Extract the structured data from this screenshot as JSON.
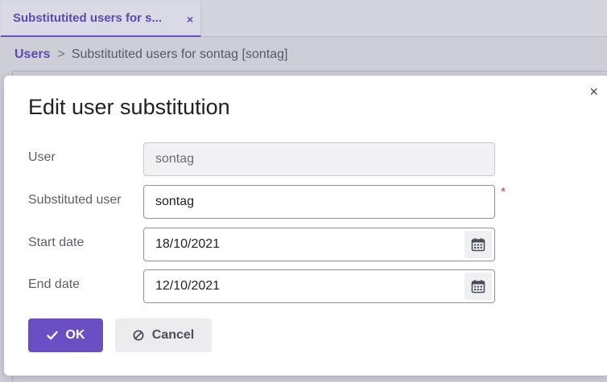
{
  "tabs": [
    {
      "label": "Substitutited users for s...",
      "close": "×"
    }
  ],
  "breadcrumb": {
    "root": "Users",
    "separator": ">",
    "current": "Substitutited users for sontag [sontag]"
  },
  "dialog": {
    "title": "Edit user substitution",
    "close": "×",
    "fields": {
      "user": {
        "label": "User",
        "value": "sontag"
      },
      "substituted_user": {
        "label": "Substituted user",
        "value": "sontag",
        "required": "*"
      },
      "start_date": {
        "label": "Start date",
        "value": "18/10/2021"
      },
      "end_date": {
        "label": "End date",
        "value": "12/10/2021"
      }
    },
    "buttons": {
      "ok": "OK",
      "cancel": "Cancel"
    }
  },
  "colors": {
    "accent": "#6a4fc4",
    "required": "#e0364b"
  },
  "icons": {
    "calendar": "calendar-icon",
    "check": "check-icon",
    "cancel": "ban-icon"
  }
}
